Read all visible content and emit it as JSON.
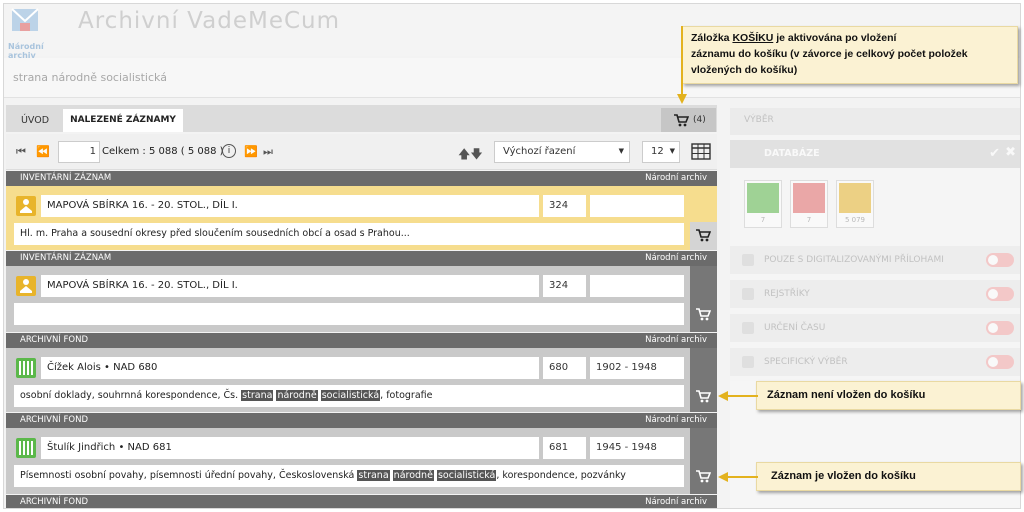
{
  "header": {
    "app_title": "Archivní VadeMeCum",
    "logo_text": "Národní archiv",
    "search_value": "strana národně socialistická"
  },
  "tabs": {
    "uvod": "ÚVOD",
    "nalezene": "NALEZENÉ ZÁZNAMY",
    "cart_count": "(4)"
  },
  "toolbar": {
    "page": "1",
    "total": "Celkem : 5 088  ( 5 088 )",
    "sort": "Výchozí řazení",
    "per_page": "12"
  },
  "records": [
    {
      "type": "INVENTÁRNÍ ZÁZNAM",
      "archive": "Národní archiv",
      "title": "MAPOVÁ SBÍRKA 16. - 20. STOL., DÍL I.",
      "number": "324",
      "date": "",
      "desc": "Hl. m. Praha a sousední okresy před sloučením sousedních obcí a osad s Prahou..."
    },
    {
      "type": "INVENTÁRNÍ ZÁZNAM",
      "archive": "Národní archiv",
      "title": "MAPOVÁ SBÍRKA 16. - 20. STOL., DÍL I.",
      "number": "324",
      "date": "",
      "desc": ""
    },
    {
      "type": "ARCHIVNÍ FOND",
      "archive": "Národní archiv",
      "title": "Čížek Alois • NAD 680",
      "number": "680",
      "date": "1902 - 1948",
      "desc_pre": "osobní doklady, souhrnná korespondence, Čs. ",
      "desc_hl1": "strana",
      "desc_hl2": "národně",
      "desc_hl3": "socialistická",
      "desc_post": ", fotografie"
    },
    {
      "type": "ARCHIVNÍ FOND",
      "archive": "Národní archiv",
      "title": "Štulík Jindřich • NAD 681",
      "number": "681",
      "date": "1945 - 1948",
      "desc_pre": "Písemnosti osobní povahy, písemnosti úřední povahy, Československá ",
      "desc_hl1": "strana",
      "desc_hl2": "národně",
      "desc_hl3": "socialistická",
      "desc_post": ", korespondence, pozvánky"
    },
    {
      "type": "ARCHIVNÍ FOND",
      "archive": "Národní archiv"
    }
  ],
  "right_panel": {
    "tab": "VÝBĚR",
    "databases": "DATABÁZE",
    "db_counts": [
      "7",
      "7",
      "5 079"
    ],
    "options": [
      "POUZE S DIGITALIZOVANÝMI PŘÍLOHAMI",
      "REJSTŘÍKY",
      "URČENÍ ČASU",
      "SPECIFICKÝ VÝBĚR"
    ]
  },
  "callouts": {
    "top_pre": "Záložka ",
    "top_keyword": "KOŠÍKU",
    "top_post": " je aktivována po vložení",
    "top_line2": "záznamu do košíku (v závorce je celkový počet položek",
    "top_line3": "vložených do košíku)",
    "not_in_cart": "Záznam není vložen do košíku",
    "in_cart": "Záznam je vložen do košíku"
  },
  "colors": {
    "highlight_row": "#f6dd8e",
    "record_header": "#6b6b6b",
    "callout_bg": "#fbf2d3",
    "arrow": "#e3b21e"
  }
}
